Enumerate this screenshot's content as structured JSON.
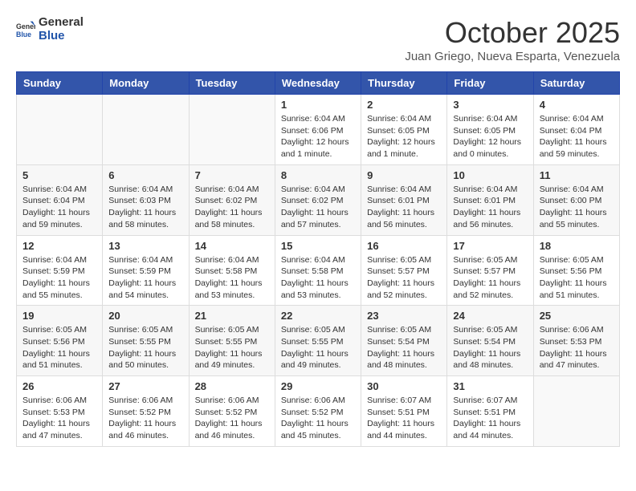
{
  "header": {
    "logo_general": "General",
    "logo_blue": "Blue",
    "month": "October 2025",
    "location": "Juan Griego, Nueva Esparta, Venezuela"
  },
  "days_of_week": [
    "Sunday",
    "Monday",
    "Tuesday",
    "Wednesday",
    "Thursday",
    "Friday",
    "Saturday"
  ],
  "weeks": [
    [
      {
        "day": "",
        "info": ""
      },
      {
        "day": "",
        "info": ""
      },
      {
        "day": "",
        "info": ""
      },
      {
        "day": "1",
        "info": "Sunrise: 6:04 AM\nSunset: 6:06 PM\nDaylight: 12 hours\nand 1 minute."
      },
      {
        "day": "2",
        "info": "Sunrise: 6:04 AM\nSunset: 6:05 PM\nDaylight: 12 hours\nand 1 minute."
      },
      {
        "day": "3",
        "info": "Sunrise: 6:04 AM\nSunset: 6:05 PM\nDaylight: 12 hours\nand 0 minutes."
      },
      {
        "day": "4",
        "info": "Sunrise: 6:04 AM\nSunset: 6:04 PM\nDaylight: 11 hours\nand 59 minutes."
      }
    ],
    [
      {
        "day": "5",
        "info": "Sunrise: 6:04 AM\nSunset: 6:04 PM\nDaylight: 11 hours\nand 59 minutes."
      },
      {
        "day": "6",
        "info": "Sunrise: 6:04 AM\nSunset: 6:03 PM\nDaylight: 11 hours\nand 58 minutes."
      },
      {
        "day": "7",
        "info": "Sunrise: 6:04 AM\nSunset: 6:02 PM\nDaylight: 11 hours\nand 58 minutes."
      },
      {
        "day": "8",
        "info": "Sunrise: 6:04 AM\nSunset: 6:02 PM\nDaylight: 11 hours\nand 57 minutes."
      },
      {
        "day": "9",
        "info": "Sunrise: 6:04 AM\nSunset: 6:01 PM\nDaylight: 11 hours\nand 56 minutes."
      },
      {
        "day": "10",
        "info": "Sunrise: 6:04 AM\nSunset: 6:01 PM\nDaylight: 11 hours\nand 56 minutes."
      },
      {
        "day": "11",
        "info": "Sunrise: 6:04 AM\nSunset: 6:00 PM\nDaylight: 11 hours\nand 55 minutes."
      }
    ],
    [
      {
        "day": "12",
        "info": "Sunrise: 6:04 AM\nSunset: 5:59 PM\nDaylight: 11 hours\nand 55 minutes."
      },
      {
        "day": "13",
        "info": "Sunrise: 6:04 AM\nSunset: 5:59 PM\nDaylight: 11 hours\nand 54 minutes."
      },
      {
        "day": "14",
        "info": "Sunrise: 6:04 AM\nSunset: 5:58 PM\nDaylight: 11 hours\nand 53 minutes."
      },
      {
        "day": "15",
        "info": "Sunrise: 6:04 AM\nSunset: 5:58 PM\nDaylight: 11 hours\nand 53 minutes."
      },
      {
        "day": "16",
        "info": "Sunrise: 6:05 AM\nSunset: 5:57 PM\nDaylight: 11 hours\nand 52 minutes."
      },
      {
        "day": "17",
        "info": "Sunrise: 6:05 AM\nSunset: 5:57 PM\nDaylight: 11 hours\nand 52 minutes."
      },
      {
        "day": "18",
        "info": "Sunrise: 6:05 AM\nSunset: 5:56 PM\nDaylight: 11 hours\nand 51 minutes."
      }
    ],
    [
      {
        "day": "19",
        "info": "Sunrise: 6:05 AM\nSunset: 5:56 PM\nDaylight: 11 hours\nand 51 minutes."
      },
      {
        "day": "20",
        "info": "Sunrise: 6:05 AM\nSunset: 5:55 PM\nDaylight: 11 hours\nand 50 minutes."
      },
      {
        "day": "21",
        "info": "Sunrise: 6:05 AM\nSunset: 5:55 PM\nDaylight: 11 hours\nand 49 minutes."
      },
      {
        "day": "22",
        "info": "Sunrise: 6:05 AM\nSunset: 5:55 PM\nDaylight: 11 hours\nand 49 minutes."
      },
      {
        "day": "23",
        "info": "Sunrise: 6:05 AM\nSunset: 5:54 PM\nDaylight: 11 hours\nand 48 minutes."
      },
      {
        "day": "24",
        "info": "Sunrise: 6:05 AM\nSunset: 5:54 PM\nDaylight: 11 hours\nand 48 minutes."
      },
      {
        "day": "25",
        "info": "Sunrise: 6:06 AM\nSunset: 5:53 PM\nDaylight: 11 hours\nand 47 minutes."
      }
    ],
    [
      {
        "day": "26",
        "info": "Sunrise: 6:06 AM\nSunset: 5:53 PM\nDaylight: 11 hours\nand 47 minutes."
      },
      {
        "day": "27",
        "info": "Sunrise: 6:06 AM\nSunset: 5:52 PM\nDaylight: 11 hours\nand 46 minutes."
      },
      {
        "day": "28",
        "info": "Sunrise: 6:06 AM\nSunset: 5:52 PM\nDaylight: 11 hours\nand 46 minutes."
      },
      {
        "day": "29",
        "info": "Sunrise: 6:06 AM\nSunset: 5:52 PM\nDaylight: 11 hours\nand 45 minutes."
      },
      {
        "day": "30",
        "info": "Sunrise: 6:07 AM\nSunset: 5:51 PM\nDaylight: 11 hours\nand 44 minutes."
      },
      {
        "day": "31",
        "info": "Sunrise: 6:07 AM\nSunset: 5:51 PM\nDaylight: 11 hours\nand 44 minutes."
      },
      {
        "day": "",
        "info": ""
      }
    ]
  ]
}
